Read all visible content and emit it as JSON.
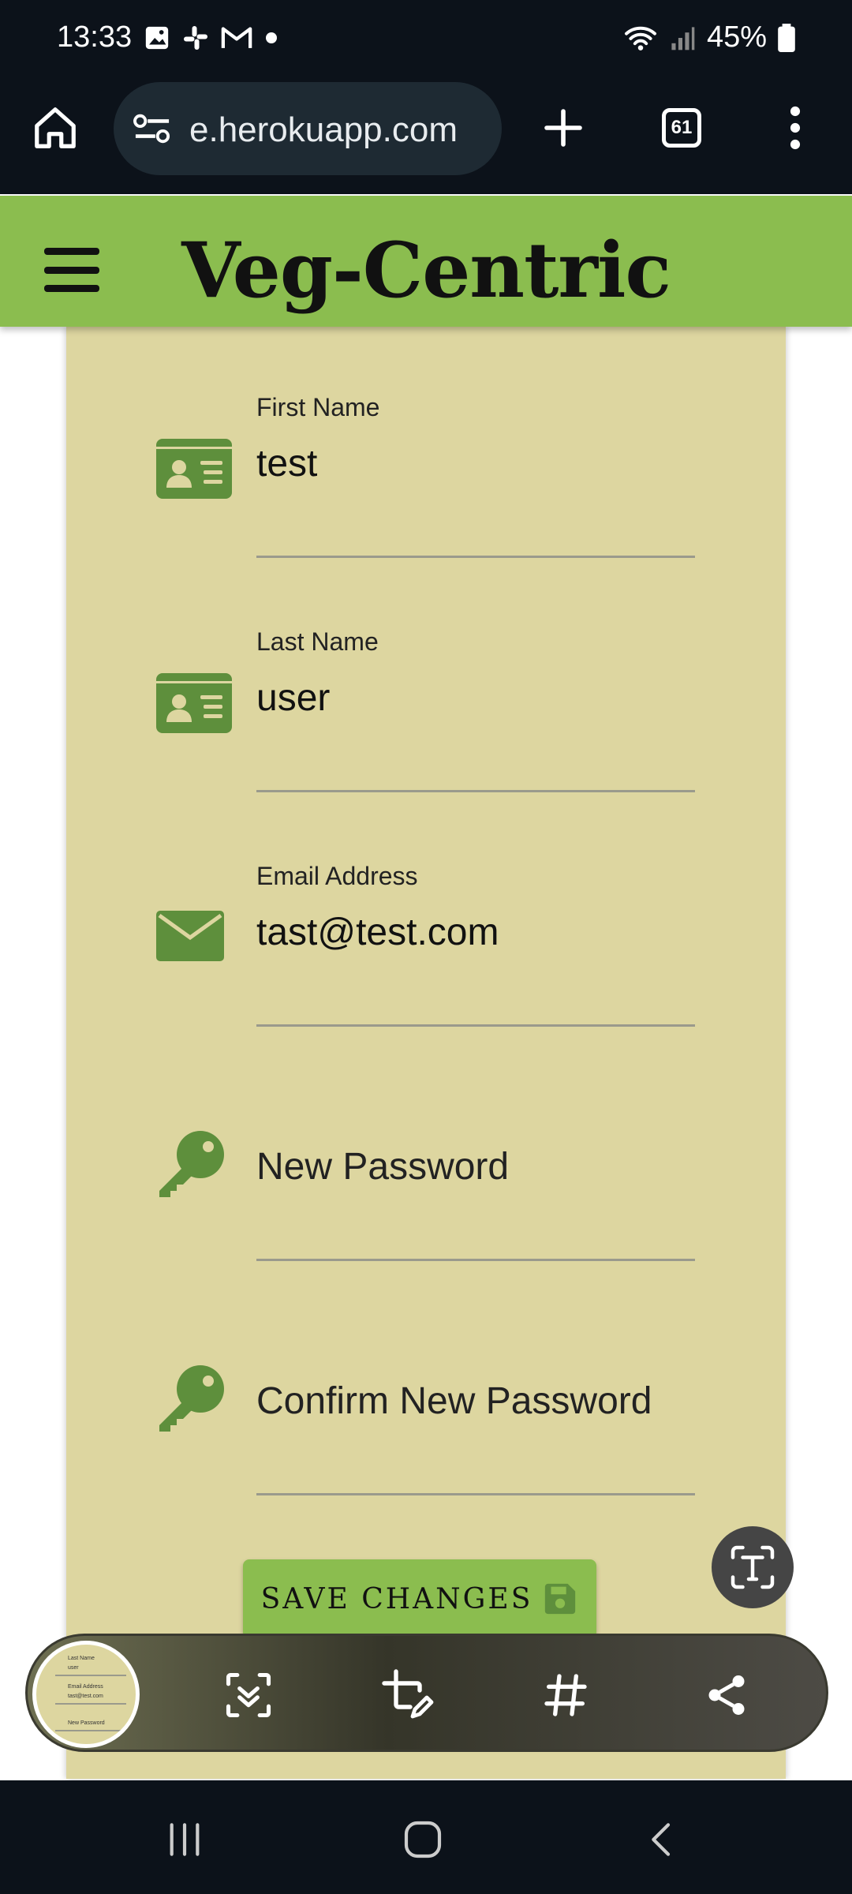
{
  "status_bar": {
    "time": "13:33",
    "battery": "45%"
  },
  "browser": {
    "url": "e.herokuapp.com",
    "tab_count": "61"
  },
  "app": {
    "title": "Veg-Centric"
  },
  "form": {
    "first_name": {
      "label": "First Name",
      "value": "test"
    },
    "last_name": {
      "label": "Last Name",
      "value": "user"
    },
    "email": {
      "label": "Email Address",
      "value": "tast@test.com"
    },
    "new_password": {
      "placeholder": "New Password"
    },
    "confirm_password": {
      "placeholder": "Confirm New Password"
    },
    "save_label": "SAVE CHANGES"
  },
  "colors": {
    "header_green": "#8bbd4f",
    "panel_khaki": "#ddd6a0",
    "icon_green": "#5e8f3c",
    "system_bar": "#0c121a"
  }
}
